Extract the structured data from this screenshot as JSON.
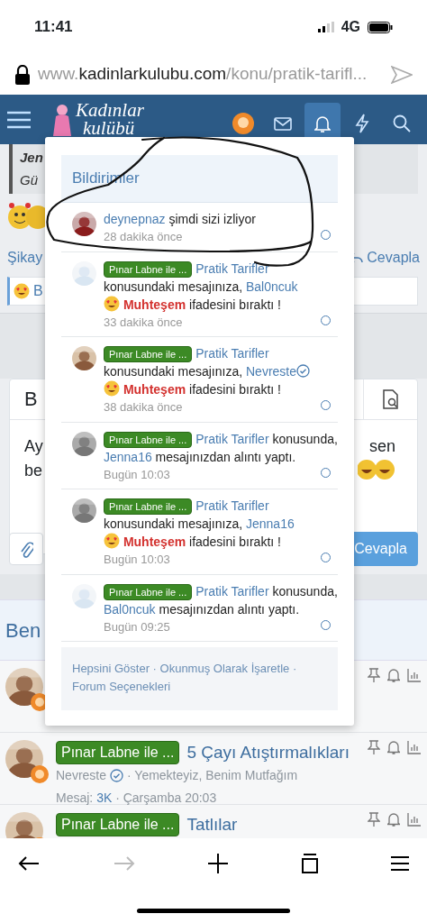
{
  "status_bar": {
    "time": "11:41",
    "network": "4G"
  },
  "address_bar": {
    "url_prefix": "www.",
    "domain": "kadinlarkulubu.com",
    "path": "/konu/pratik-tarifl..."
  },
  "navbar": {
    "logo_line_1": "Kadınlar",
    "logo_line_2": "kulübü",
    "items": [
      {
        "kind": "avatar",
        "selected": false
      },
      {
        "kind": "mail",
        "selected": false
      },
      {
        "kind": "bell",
        "selected": true
      },
      {
        "kind": "bolt",
        "selected": false
      },
      {
        "kind": "search",
        "selected": false
      }
    ]
  },
  "background": {
    "quote_author": "Jen",
    "quote_date": "Gü",
    "report_link": "Şikay",
    "reply_link": "Cevapla",
    "reaction_text": "B",
    "editor_bold": "B",
    "editor_line_1": "Ay",
    "editor_line_2": "be",
    "editor_right": "sen",
    "reply_button": "Cevapla",
    "similar_heading": "Ben"
  },
  "notifications": {
    "title": "Bildirimler",
    "items": [
      {
        "kind": "follow",
        "user": "deynepnaz",
        "text_1": "şimdi sizi izliyor",
        "time": "28 dakika önce"
      },
      {
        "kind": "reaction",
        "prefix": "Pınar Labne ile ...",
        "thread": "Pratik Tarifler",
        "text_1": "konusundaki mesajınıza,",
        "user": "Bal0ncuk",
        "verified": false,
        "reaction": "Muhteşem",
        "text_2": "ifadesini bıraktı !",
        "time": "33 dakika önce"
      },
      {
        "kind": "reaction",
        "prefix": "Pınar Labne ile ...",
        "thread": "Pratik Tarifler",
        "text_1": "konusundaki mesajınıza,",
        "user": "Nevreste",
        "verified": true,
        "reaction": "Muhteşem",
        "text_2": "ifadesini bıraktı !",
        "time": "38 dakika önce"
      },
      {
        "kind": "quote",
        "prefix": "Pınar Labne ile ...",
        "thread": "Pratik Tarifler",
        "text_1": "konusunda,",
        "user": "Jenna16",
        "verified": false,
        "text_2": "mesajınızdan alıntı yaptı.",
        "time": "Bugün 10:03"
      },
      {
        "kind": "reaction",
        "prefix": "Pınar Labne ile ...",
        "thread": "Pratik Tarifler",
        "text_1": "konusundaki mesajınıza,",
        "user": "Jenna16",
        "verified": false,
        "reaction": "Muhteşem",
        "text_2": "ifadesini bıraktı !",
        "time": "Bugün 10:03"
      },
      {
        "kind": "quote",
        "prefix": "Pınar Labne ile ...",
        "thread": "Pratik Tarifler",
        "text_1": "konusunda,",
        "user": "Bal0ncuk",
        "verified": false,
        "text_2": "mesajınızdan alıntı yaptı.",
        "time": "Bugün 09:25"
      }
    ],
    "footer_links": [
      "Hepsini Göster",
      "Okunmuş Olarak İşaretle",
      "Forum Seçenekleri"
    ],
    "separator": "·"
  },
  "threads": [
    {
      "prefix": "Pınar Labne ile ...",
      "title": "5 Çayı Atıştırmalıkları",
      "author": "Nevreste",
      "verified": true,
      "separator": "·",
      "forums": "Yemekteyiz, Benim Mutfağım",
      "replies_label": "Mesaj:",
      "replies": "3K",
      "date": "Çarşamba 20:03"
    },
    {
      "prefix": "Pınar Labne ile ...",
      "title": "Tatlılar"
    }
  ],
  "browser_toolbar": {
    "forward_disabled": true
  }
}
